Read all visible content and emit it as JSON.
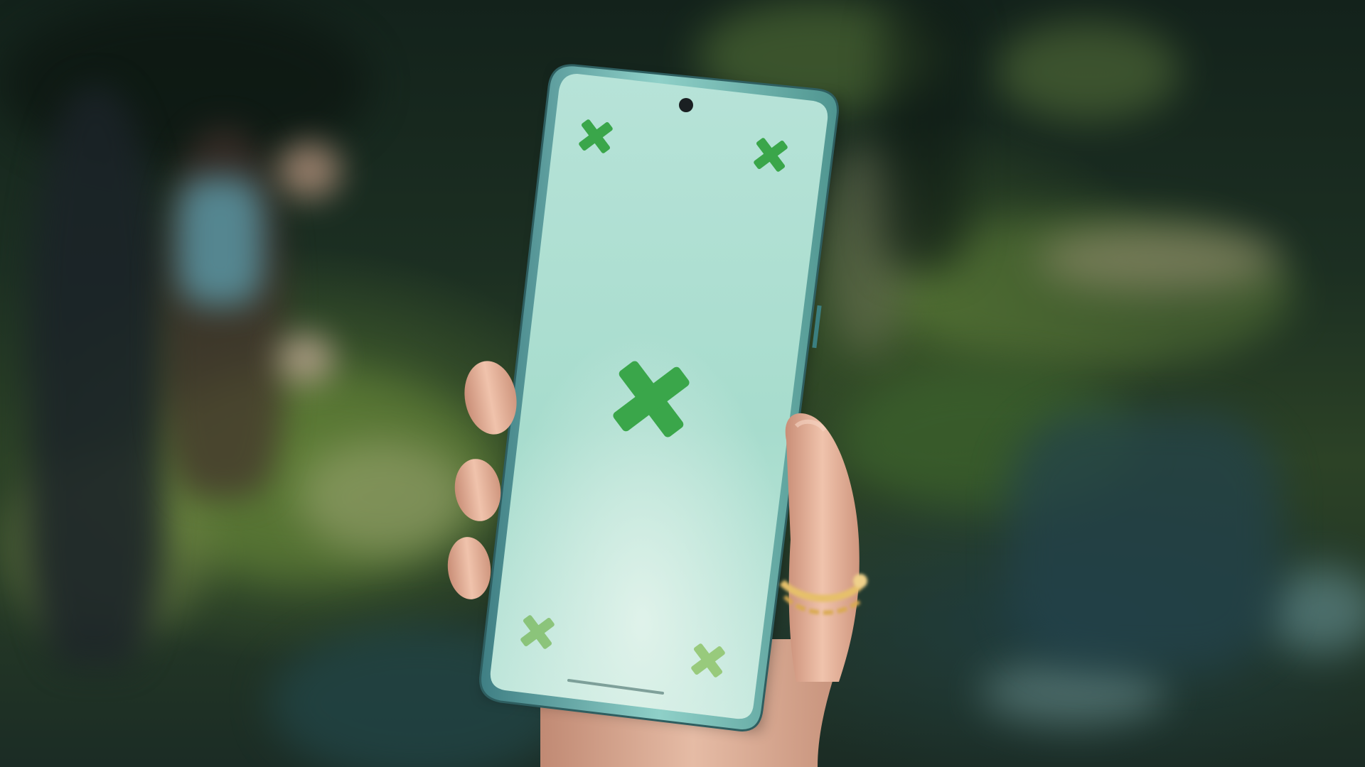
{
  "scene": {
    "description_kind": "photo",
    "colors": {
      "screen_green": "#3aa64a",
      "screen_bg": "#bfe6da",
      "phone_frame": "#6fb5b0",
      "background_dark": "#13221b",
      "grass": "#4c6a30",
      "skin": "#e9b9a0",
      "ring_gold": "#e6c06a"
    }
  },
  "phone": {
    "screen_markers": [
      {
        "name": "tracking-marker-top-left-icon",
        "size": "small"
      },
      {
        "name": "tracking-marker-top-right-icon",
        "size": "small"
      },
      {
        "name": "tracking-marker-center-icon",
        "size": "large"
      },
      {
        "name": "tracking-marker-bottom-left-icon",
        "size": "small"
      },
      {
        "name": "tracking-marker-bottom-right-icon",
        "size": "small"
      }
    ]
  }
}
